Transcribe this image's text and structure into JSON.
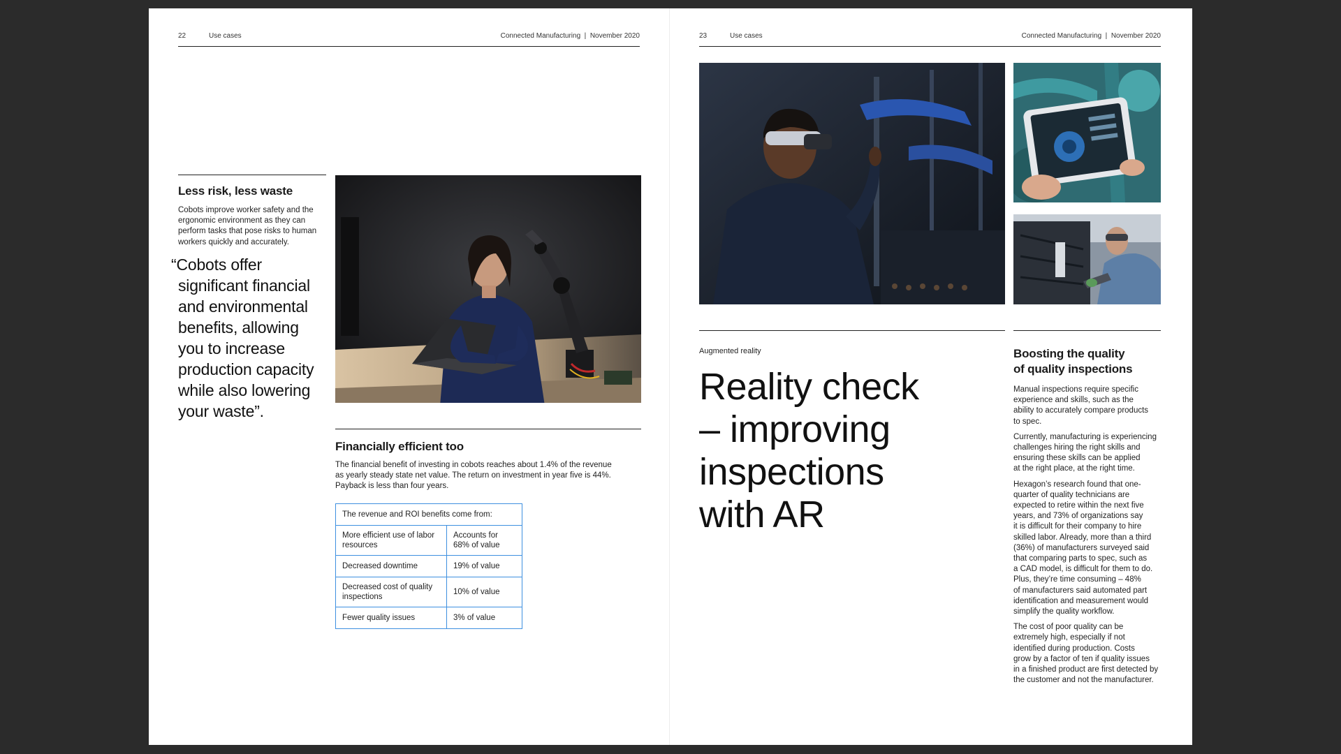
{
  "left_page": {
    "page_number": "22",
    "section": "Use cases",
    "publication": "Connected Manufacturing  |  November 2020",
    "less_risk": {
      "heading": "Less risk, less waste",
      "lines": [
        "Cobots improve worker safety and the",
        "ergonomic environment as they can",
        "perform tasks that pose risks to human",
        "workers quickly and accurately."
      ]
    },
    "quote_lines": [
      "“Cobots offer",
      "significant financial",
      "and environmental",
      "benefits, allowing",
      "you to increase",
      "production capacity",
      "while also lowering",
      "your waste”."
    ],
    "financial": {
      "heading": "Financially efficient too",
      "lines": [
        "The financial benefit of investing in cobots reaches about 1.4% of the revenue",
        "as yearly steady state net value. The return on investment in year five is 44%.",
        "Payback is less than four years."
      ]
    },
    "table": {
      "header": "The revenue and ROI benefits come from:",
      "rows": [
        {
          "item": "More efficient use of labor resources",
          "value": "Accounts for 68% of value"
        },
        {
          "item": "Decreased downtime",
          "value": "19% of value"
        },
        {
          "item": "Decreased cost of quality inspections",
          "value": "10% of value"
        },
        {
          "item": "Fewer quality issues",
          "value": "3% of value"
        }
      ]
    }
  },
  "right_page": {
    "page_number": "23",
    "section": "Use cases",
    "publication": "Connected Manufacturing  |  November 2020",
    "kicker": "Augmented reality",
    "title_lines": [
      "Reality check",
      "– improving",
      "inspections",
      "with AR"
    ],
    "boosting": {
      "heading_lines": [
        "Boosting the quality",
        "of quality inspections"
      ],
      "paragraphs": [
        [
          "Manual inspections require specific",
          "experience and skills, such as the",
          "ability to accurately compare products",
          "to spec."
        ],
        [
          "Currently, manufacturing is experiencing",
          "challenges hiring the right skills and",
          "ensuring these skills can be applied",
          "at the right place, at the right time."
        ],
        [
          "Hexagon’s research found that one-",
          "quarter of quality technicians are",
          "expected to retire within the next five",
          "years, and 73% of organizations say",
          "it is difficult for their company to hire",
          "skilled labor. Already, more than a third",
          "(36%) of manufacturers surveyed said",
          "that comparing parts to spec, such as",
          "a CAD model, is difficult for them to do.",
          "Plus, they’re time consuming – 48%",
          "of manufacturers said automated part",
          "identification and measurement would",
          "simplify the quality workflow."
        ],
        [
          "The cost of poor quality can be",
          "extremely high, especially if not",
          "identified during production. Costs",
          "grow by a factor of ten if quality issues",
          "in a finished product are first detected by",
          "the customer and not the manufacturer."
        ]
      ]
    }
  }
}
